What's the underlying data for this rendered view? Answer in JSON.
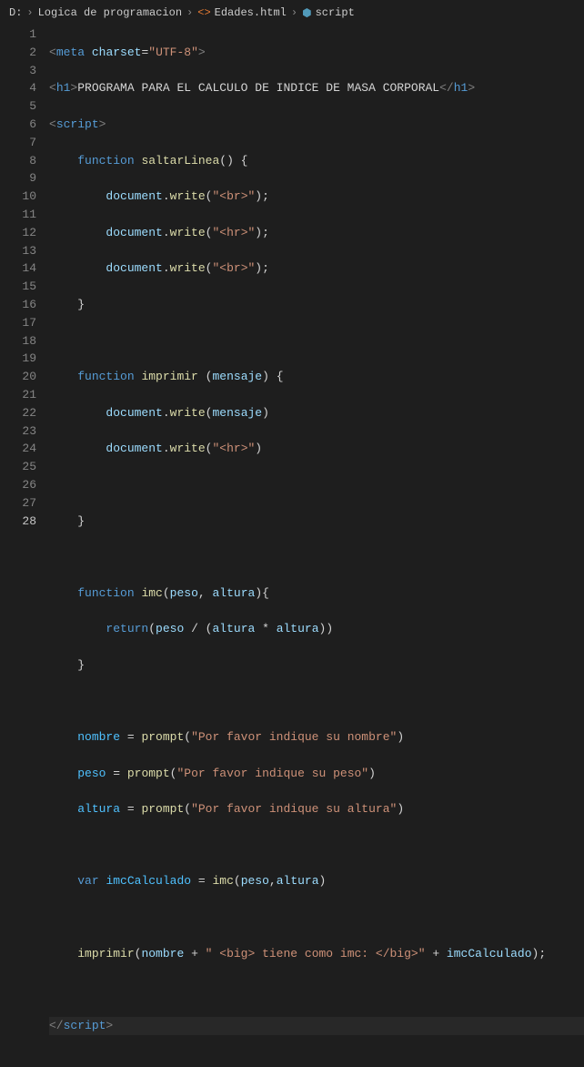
{
  "breadcrumb": {
    "drive": "D:",
    "folder": "Logica de programacion",
    "file": "Edades.html",
    "symbol": "script"
  },
  "code": {
    "l1": {
      "tag_open": "<",
      "tag": "meta",
      "attr": "charset",
      "eq": "=",
      "val": "\"UTF-8\"",
      "tag_close": ">"
    },
    "l2": {
      "open": "<",
      "h1": "h1",
      "gt": ">",
      "text": "PROGRAMA PARA EL CALCULO DE INDICE DE MASA CORPORAL",
      "close_open": "</",
      "close_gt": ">"
    },
    "l3": {
      "open": "<",
      "script": "script",
      "gt": ">"
    },
    "l4": {
      "kw": "function",
      "fn": "saltarLinea",
      "paren": "() {"
    },
    "l5": {
      "obj": "document",
      "dot": ".",
      "write": "write",
      "open": "(",
      "str": "\"<br>\"",
      "close": ");"
    },
    "l6": {
      "obj": "document",
      "dot": ".",
      "write": "write",
      "open": "(",
      "str": "\"<hr>\"",
      "close": ");"
    },
    "l7": {
      "obj": "document",
      "dot": ".",
      "write": "write",
      "open": "(",
      "str": "\"<br>\"",
      "close": ");"
    },
    "l8": {
      "brace": "}"
    },
    "l10": {
      "kw": "function",
      "fn": "imprimir",
      "paren": " (",
      "arg": "mensaje",
      "close": ") {"
    },
    "l11": {
      "obj": "document",
      "dot": ".",
      "write": "write",
      "open": "(",
      "arg": "mensaje",
      "close": ")"
    },
    "l12": {
      "obj": "document",
      "dot": ".",
      "write": "write",
      "open": "(",
      "str": "\"<hr>\"",
      "close": ")"
    },
    "l14": {
      "brace": "}"
    },
    "l16": {
      "kw": "function",
      "fn": "imc",
      "open": "(",
      "a1": "peso",
      "comma": ", ",
      "a2": "altura",
      "close": "){"
    },
    "l17": {
      "ret": "return",
      "open": "(",
      "a1": "peso",
      "op": " / (",
      "a2": "altura",
      "mul": " * ",
      "a3": "altura",
      "close": "))"
    },
    "l18": {
      "brace": "}"
    },
    "l20": {
      "var": "nombre",
      "eq": " = ",
      "fn": "prompt",
      "open": "(",
      "str": "\"Por favor indique su nombre\"",
      "close": ")"
    },
    "l21": {
      "var": "peso",
      "eq": " = ",
      "fn": "prompt",
      "open": "(",
      "str": "\"Por favor indique su peso\"",
      "close": ")"
    },
    "l22": {
      "var": "altura",
      "eq": " = ",
      "fn": "prompt",
      "open": "(",
      "str": "\"Por favor indique su altura\"",
      "close": ")"
    },
    "l24": {
      "kw": "var",
      "var": "imcCalculado",
      "eq": " = ",
      "fn": "imc",
      "open": "(",
      "a1": "peso",
      "comma": ",",
      "a2": "altura",
      "close": ")"
    },
    "l26": {
      "fn": "imprimir",
      "open": "(",
      "v1": "nombre",
      "plus1": " + ",
      "str": "\" <big> tiene como imc: </big>\"",
      "plus2": " + ",
      "v2": "imcCalculado",
      "close": ");"
    },
    "l28": {
      "open": "</",
      "script": "script",
      "gt": ">"
    }
  },
  "lines": [
    "1",
    "2",
    "3",
    "4",
    "5",
    "6",
    "7",
    "8",
    "9",
    "10",
    "11",
    "12",
    "13",
    "14",
    "15",
    "16",
    "17",
    "18",
    "19",
    "20",
    "21",
    "22",
    "23",
    "24",
    "25",
    "26",
    "27",
    "28"
  ]
}
